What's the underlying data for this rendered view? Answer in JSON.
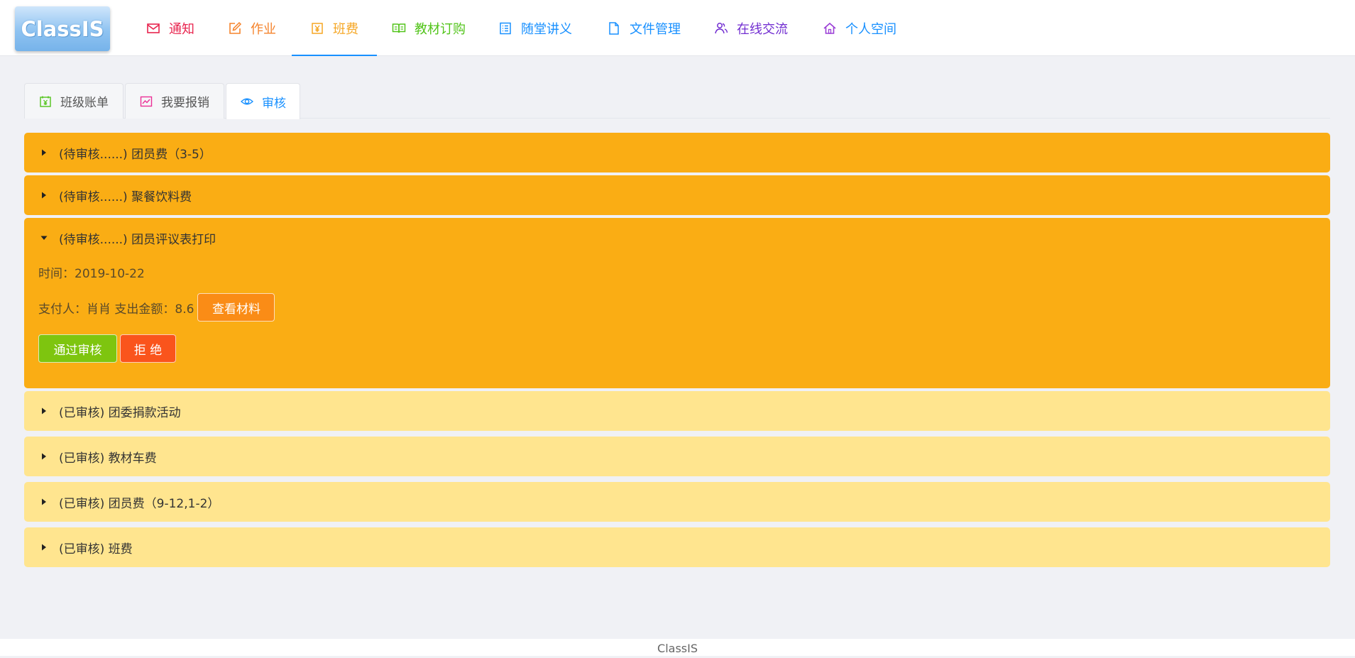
{
  "app": {
    "logo_text": "ClassIS"
  },
  "nav": {
    "items": [
      {
        "label": "通知",
        "icon": "mail-icon",
        "color": "#e8244e"
      },
      {
        "label": "作业",
        "icon": "edit-icon",
        "color": "#f5832b"
      },
      {
        "label": "班费",
        "icon": "yuan-icon",
        "color": "#f5a623",
        "active": true
      },
      {
        "label": "教材订购",
        "icon": "book-icon",
        "color": "#52c41a"
      },
      {
        "label": "随堂讲义",
        "icon": "list-icon",
        "color": "#1890ff"
      },
      {
        "label": "文件管理",
        "icon": "file-icon",
        "color": "#1890ff"
      },
      {
        "label": "在线交流",
        "icon": "users-icon",
        "color": "#722ed1"
      },
      {
        "label": "个人空间",
        "icon": "home-icon",
        "color": "#1890ff"
      }
    ]
  },
  "tabs": [
    {
      "label": "班级账单",
      "icon": "calendar-yuan-icon",
      "color": "#52c41a"
    },
    {
      "label": "我要报销",
      "icon": "line-chart-icon",
      "color": "#eb2f96"
    },
    {
      "label": "审核",
      "icon": "eye-icon",
      "color": "#1890ff",
      "active": true
    }
  ],
  "review": {
    "items": [
      {
        "title": "(待审核......) 团员费（3-5）",
        "status": "pending",
        "expanded": false
      },
      {
        "title": "(待审核......) 聚餐饮料费",
        "status": "pending",
        "expanded": false
      },
      {
        "title": "(待审核......) 团员评议表打印",
        "status": "pending",
        "expanded": true,
        "time_line": "时间：2019-10-22",
        "payer_line": "支付人：肖肖 支出金额：8.6",
        "view_material_label": "查看材料",
        "approve_label": "通过审核",
        "reject_label": "拒 绝"
      },
      {
        "title": "(已审核) 团委捐款活动",
        "status": "done",
        "expanded": false
      },
      {
        "title": "(已审核) 教材车费",
        "status": "done",
        "expanded": false
      },
      {
        "title": "(已审核) 团员费（9-12,1-2）",
        "status": "done",
        "expanded": false
      },
      {
        "title": "(已审核) 班费",
        "status": "done",
        "expanded": false
      }
    ]
  },
  "colors": {
    "pending": "#faad14",
    "done": "#ffe58f",
    "accent": "#1890ff"
  },
  "footer": {
    "text": "ClassIS"
  }
}
